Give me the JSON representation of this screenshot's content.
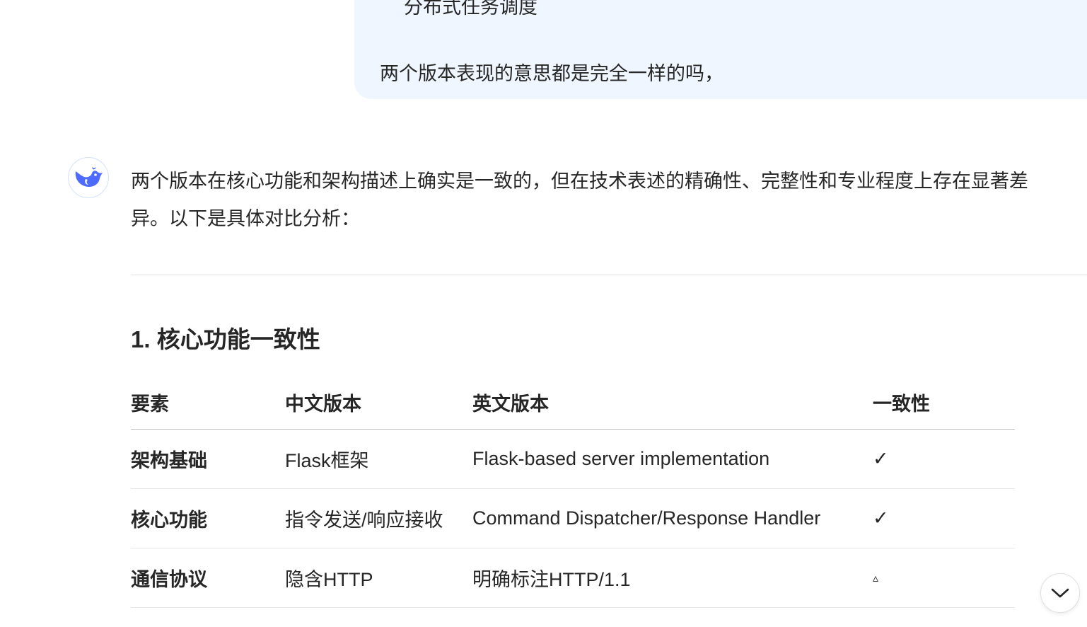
{
  "user_message": {
    "previous_line": "分布式任务调度",
    "question": "两个版本表现的意思都是完全一样的吗，"
  },
  "assistant": {
    "avatar_icon": "whale-logo-icon",
    "accent_color": "#4d6bfe",
    "intro_line_1": "两个版本在核心功能和架构描述上确实是一致的，但在技术表述的精确性、完整性和专业程度上存在显著差",
    "intro_line_2": "异。以下是具体对比分析：",
    "section_heading": "1. 核心功能一致性",
    "table": {
      "headers": [
        "要素",
        "中文版本",
        "英文版本",
        "一致性"
      ],
      "rows": [
        [
          "架构基础",
          "Flask框架",
          "Flask-based server implementation",
          "✓"
        ],
        [
          "核心功能",
          "指令发送/响应接收",
          "Command Dispatcher/Response Handler",
          "✓"
        ],
        [
          "通信协议",
          "隐含HTTP",
          "明确标注HTTP/1.1",
          "▵"
        ]
      ]
    }
  },
  "controls": {
    "scroll_down_icon": "chevron-down-icon"
  }
}
